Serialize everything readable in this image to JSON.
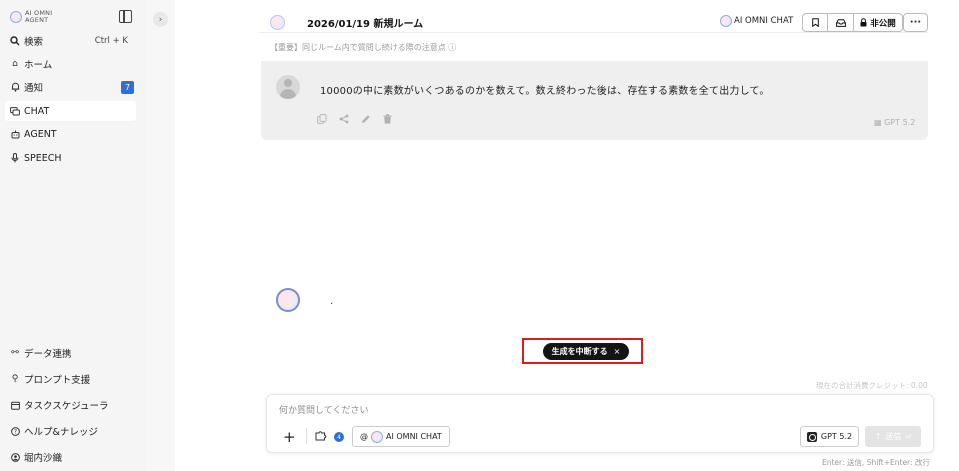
{
  "sidebar": {
    "logo_text": "AI OMNI AGENT",
    "search": {
      "label": "検索",
      "shortcut": "Ctrl + K"
    },
    "items": [
      {
        "label": "ホーム",
        "icon": "home-icon"
      },
      {
        "label": "通知",
        "icon": "bell-icon",
        "badge": "7"
      },
      {
        "label": "CHAT",
        "icon": "chat-icon",
        "active": true
      },
      {
        "label": "AGENT",
        "icon": "agent-icon"
      },
      {
        "label": "SPEECH",
        "icon": "mic-icon"
      }
    ],
    "bottom_items": [
      {
        "label": "データ連携",
        "icon": "link-icon"
      },
      {
        "label": "プロンプト支援",
        "icon": "prompt-icon"
      },
      {
        "label": "タスクスケジューラ",
        "icon": "calendar-icon"
      },
      {
        "label": "ヘルプ&ナレッジ",
        "icon": "help-icon"
      },
      {
        "label": "堀内沙織",
        "icon": "user-icon"
      }
    ]
  },
  "header": {
    "room_title": "2026/01/19 新規ルーム",
    "notice": "【重要】同じルーム内で質問し続ける際の注意点 ⓘ",
    "model_tag": "AI OMNI CHAT",
    "visibility": "非公開"
  },
  "messages": {
    "user_text": "10000の中に素数がいくつあるのかを数えて。数え終わった後は、存在する素数を全て出力して。",
    "user_model": "GPT 5.2",
    "assistant_text": "."
  },
  "stop_button": {
    "label": "生成を中断する",
    "close": "×"
  },
  "credits": "現在の合計消費クレジット: 0.00",
  "input": {
    "placeholder": "何か質問してください",
    "value": "",
    "agent_chip": "AI OMNI CHAT",
    "agent_prefix": "@",
    "tool_badge": "4",
    "model": "GPT 5.2",
    "send_label": "送信",
    "hint": "Enter: 送信, Shift+Enter: 改行"
  },
  "colors": {
    "accent": "#2f6fd6",
    "highlight_frame": "#d61f1f",
    "stop_button_bg": "#141414"
  }
}
